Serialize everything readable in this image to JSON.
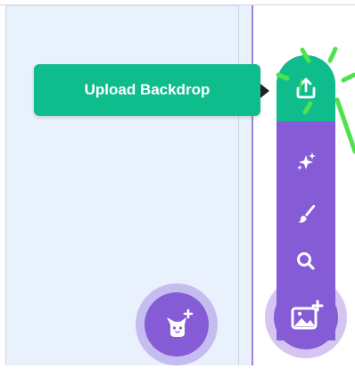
{
  "tooltip": {
    "label": "Upload Backdrop"
  },
  "backdrop_menu": {
    "items": [
      {
        "name": "upload",
        "icon": "upload-icon",
        "active": true
      },
      {
        "name": "surprise",
        "icon": "sparkle-icon",
        "active": false
      },
      {
        "name": "paint",
        "icon": "paintbrush-icon",
        "active": false
      },
      {
        "name": "search",
        "icon": "search-icon",
        "active": false
      }
    ],
    "main_icon": "backdrop-image-add-icon"
  },
  "sprite_button": {
    "icon": "cat-add-icon"
  },
  "colors": {
    "accent_purple": "#855cd6",
    "highlight_green": "#0fbd8c",
    "burst_green": "#4ee34a",
    "pane_background": "#e9f1fc"
  }
}
